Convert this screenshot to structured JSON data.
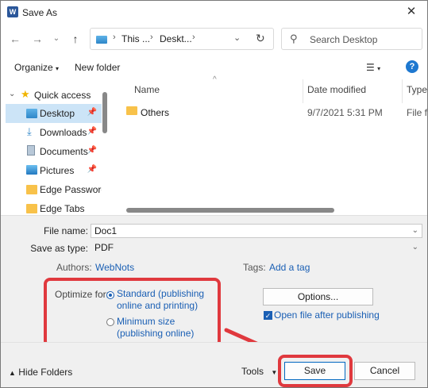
{
  "window": {
    "title": "Save As",
    "app_icon_letter": "W"
  },
  "nav": {
    "back_icon": "back-arrow-icon",
    "forward_icon": "forward-arrow-icon",
    "up_icon": "up-arrow-icon",
    "breadcrumb": [
      "This ...",
      "Deskt..."
    ],
    "search_placeholder": "Search Desktop"
  },
  "toolbar": {
    "organize": "Organize",
    "new_folder": "New folder",
    "help": "?"
  },
  "sidebar": {
    "items": [
      {
        "label": "Quick access",
        "icon": "star-icon",
        "expander": "⌄"
      },
      {
        "label": "Desktop",
        "icon": "desktop-icon",
        "pinned": true,
        "selected": true
      },
      {
        "label": "Downloads",
        "icon": "download-icon",
        "pinned": true
      },
      {
        "label": "Documents",
        "icon": "documents-icon",
        "pinned": true
      },
      {
        "label": "Pictures",
        "icon": "pictures-icon",
        "pinned": true
      },
      {
        "label": "Edge Password M",
        "icon": "folder-icon"
      },
      {
        "label": "Edge Tabs",
        "icon": "folder-icon"
      }
    ]
  },
  "filelist": {
    "columns": [
      "Name",
      "Date modified",
      "Type"
    ],
    "rows": [
      {
        "name": "Others",
        "date": "9/7/2021 5:31 PM",
        "type": "File fo"
      }
    ]
  },
  "form": {
    "file_name_label": "File name:",
    "file_name_value": "Doc1",
    "save_type_label": "Save as type:",
    "save_type_value": "PDF",
    "authors_label": "Authors:",
    "authors_value": "WebNots",
    "tags_label": "Tags:",
    "tags_value": "Add a tag",
    "optimize_label": "Optimize for:",
    "opt_standard_line1": "Standard (publishing",
    "opt_standard_line2": "online and printing)",
    "opt_minimum_line1": "Minimum size",
    "opt_minimum_line2": "(publishing online)",
    "options_button": "Options...",
    "open_after_label": "Open file after publishing"
  },
  "footer": {
    "hide_folders": "Hide Folders",
    "tools": "Tools",
    "save": "Save",
    "cancel": "Cancel"
  },
  "colors": {
    "highlight": "#e0393e",
    "accent": "#1a5fb4",
    "selection": "#cce4f7"
  }
}
